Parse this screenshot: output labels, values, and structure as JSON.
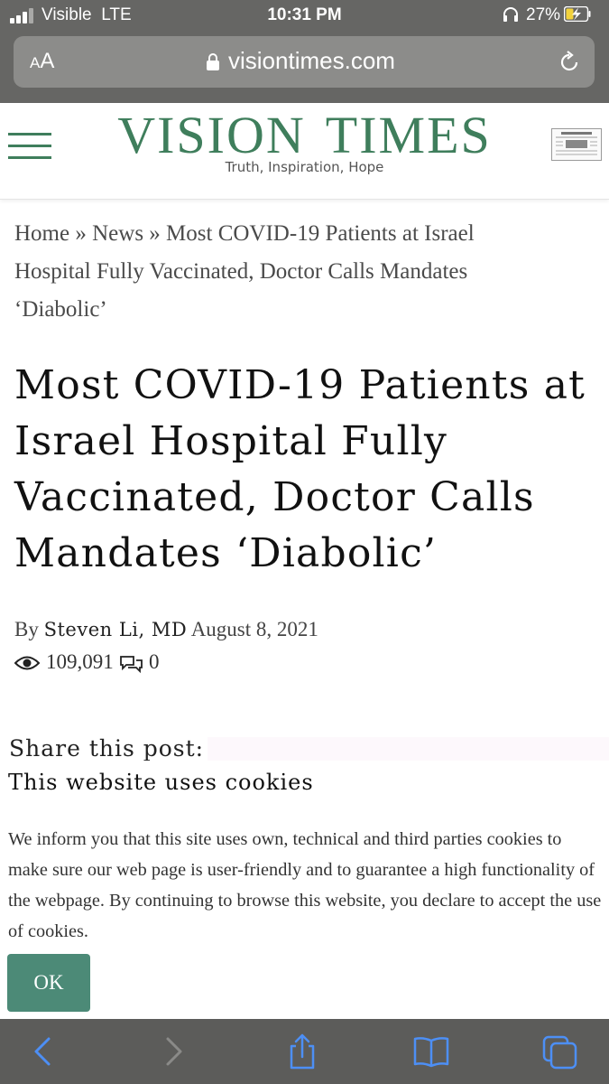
{
  "status_bar": {
    "carrier": "Visible",
    "network": "LTE",
    "time": "10:31 PM",
    "battery_percent": "27%",
    "icons": [
      "signal-icon",
      "headphones-icon",
      "battery-charging-icon"
    ]
  },
  "browser": {
    "text_size_label": "AA",
    "url": "visiontimes.com",
    "icons": [
      "lock-icon",
      "reload-icon"
    ]
  },
  "site": {
    "logo_word1": "VISION",
    "logo_word2": "TIMES",
    "tagline": "Truth, Inspiration, Hope",
    "brand_color": "#3f7e5c",
    "icons": [
      "hamburger-menu-icon",
      "newspaper-icon"
    ]
  },
  "breadcrumb": {
    "home": "Home",
    "separator": "»",
    "news": "News",
    "current": "Most COVID-19 Patients at Israel Hospital Fully Vaccinated, Doctor Calls Mandates ‘Diabolic’"
  },
  "article": {
    "title": "Most COVID-19 Patients at Israel Hospital Fully Vaccinated, Doctor Calls Mandates ‘Diabolic’",
    "by_label": "By",
    "author": "Steven Li, MD",
    "date": "August 8, 2021",
    "views": "109,091",
    "comments": "0",
    "share_label": "Share this post:"
  },
  "cookie_banner": {
    "title": "This website uses cookies",
    "body": "We inform you that this site uses own, technical and third parties cookies to make sure our web page is user-friendly and to guarantee a high functionality of the webpage. By continuing to browse this website, you declare to accept the use of cookies.",
    "ok_label": "OK",
    "button_color": "#4c8a77"
  },
  "toolbar": {
    "icons": [
      "back-icon",
      "forward-icon",
      "share-icon",
      "bookmarks-icon",
      "tabs-icon"
    ]
  }
}
